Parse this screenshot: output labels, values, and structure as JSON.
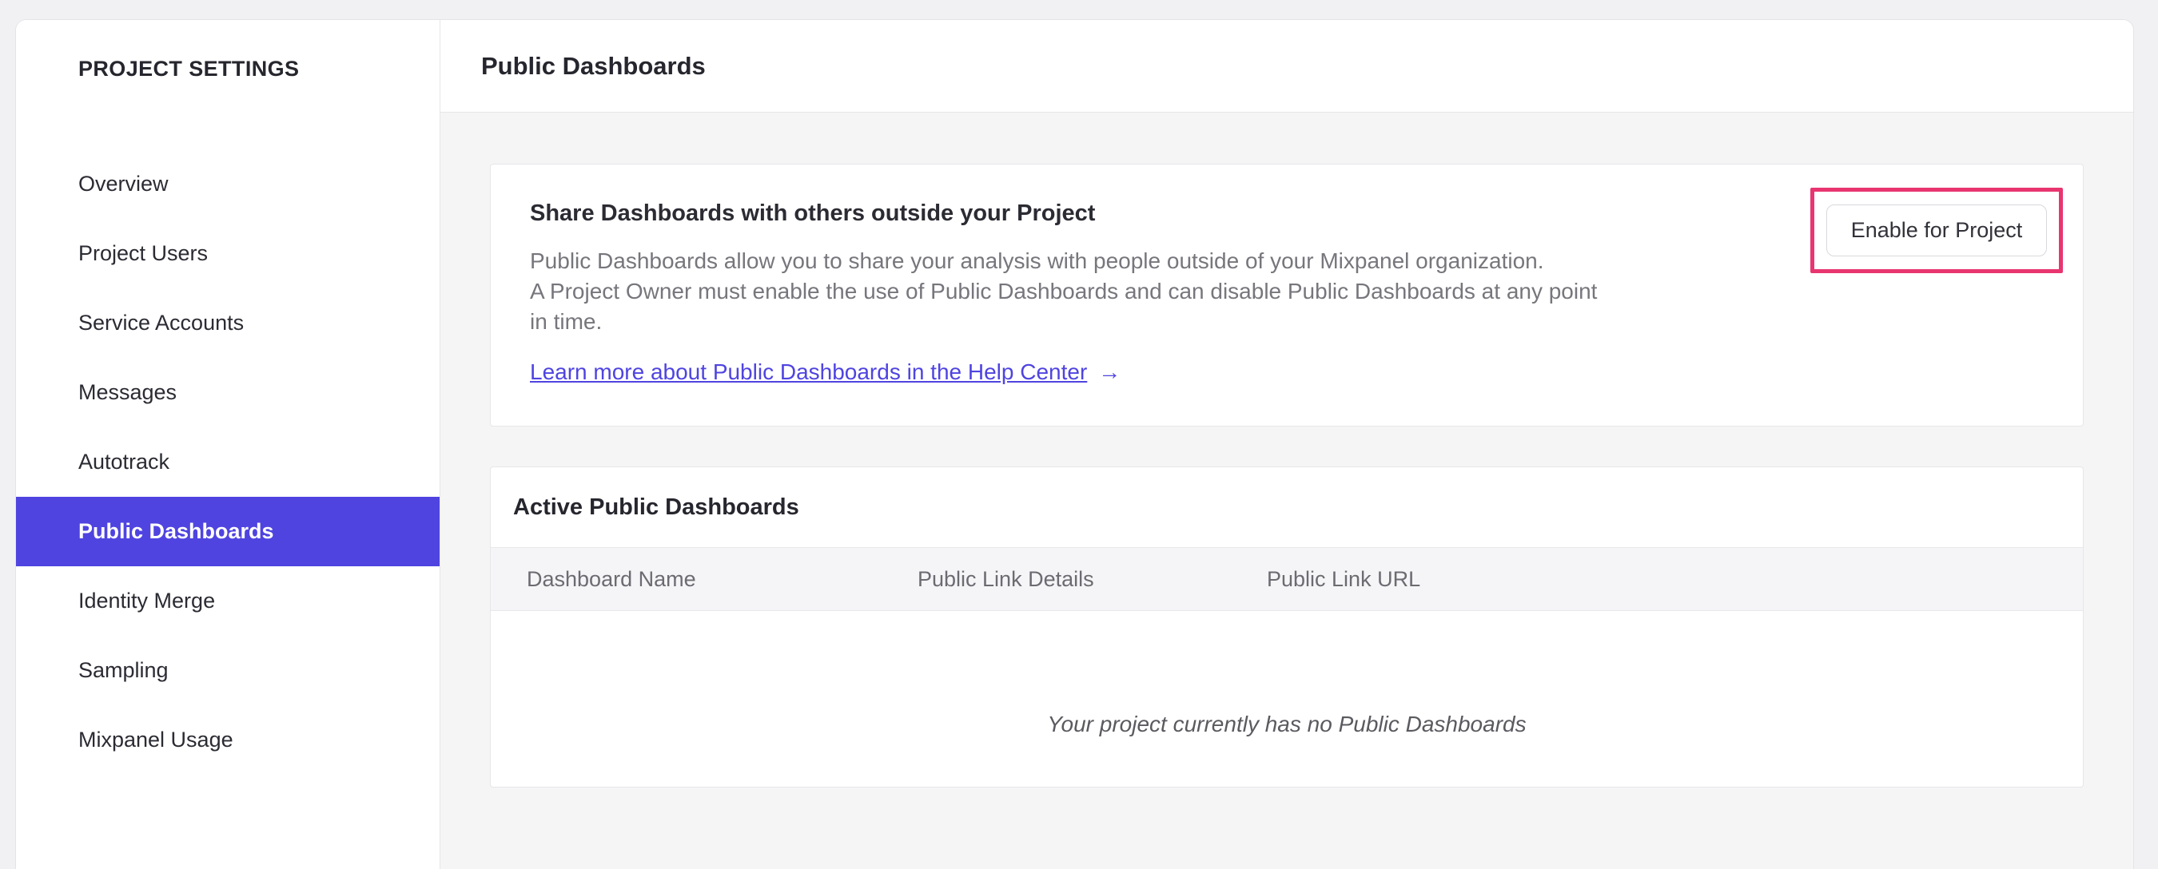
{
  "sidebar": {
    "title": "PROJECT SETTINGS",
    "items": [
      {
        "label": "Overview",
        "selected": false
      },
      {
        "label": "Project Users",
        "selected": false
      },
      {
        "label": "Service Accounts",
        "selected": false
      },
      {
        "label": "Messages",
        "selected": false
      },
      {
        "label": "Autotrack",
        "selected": false
      },
      {
        "label": "Public Dashboards",
        "selected": true
      },
      {
        "label": "Identity Merge",
        "selected": false
      },
      {
        "label": "Sampling",
        "selected": false
      },
      {
        "label": "Mixpanel Usage",
        "selected": false
      }
    ]
  },
  "header": {
    "title": "Public Dashboards"
  },
  "share_card": {
    "heading": "Share Dashboards with others outside your Project",
    "description_line1": "Public Dashboards allow you to share your analysis with people outside of your Mixpanel organization.",
    "description_line2": "A Project Owner must enable the use of Public Dashboards and can disable Public Dashboards at any point",
    "description_line3": "in time.",
    "link_label": "Learn more about Public Dashboards in the Help Center",
    "link_arrow": "→",
    "enable_button_label": "Enable for Project"
  },
  "active_card": {
    "heading": "Active Public Dashboards",
    "columns": [
      "Dashboard Name",
      "Public Link Details",
      "Public Link URL"
    ],
    "empty_message": "Your project currently has no Public Dashboards"
  },
  "colors": {
    "accent_purple": "#4f44e0",
    "annotation_pink": "#e83570",
    "page_background": "#f1f1f3",
    "body_background": "#f5f5f6"
  }
}
